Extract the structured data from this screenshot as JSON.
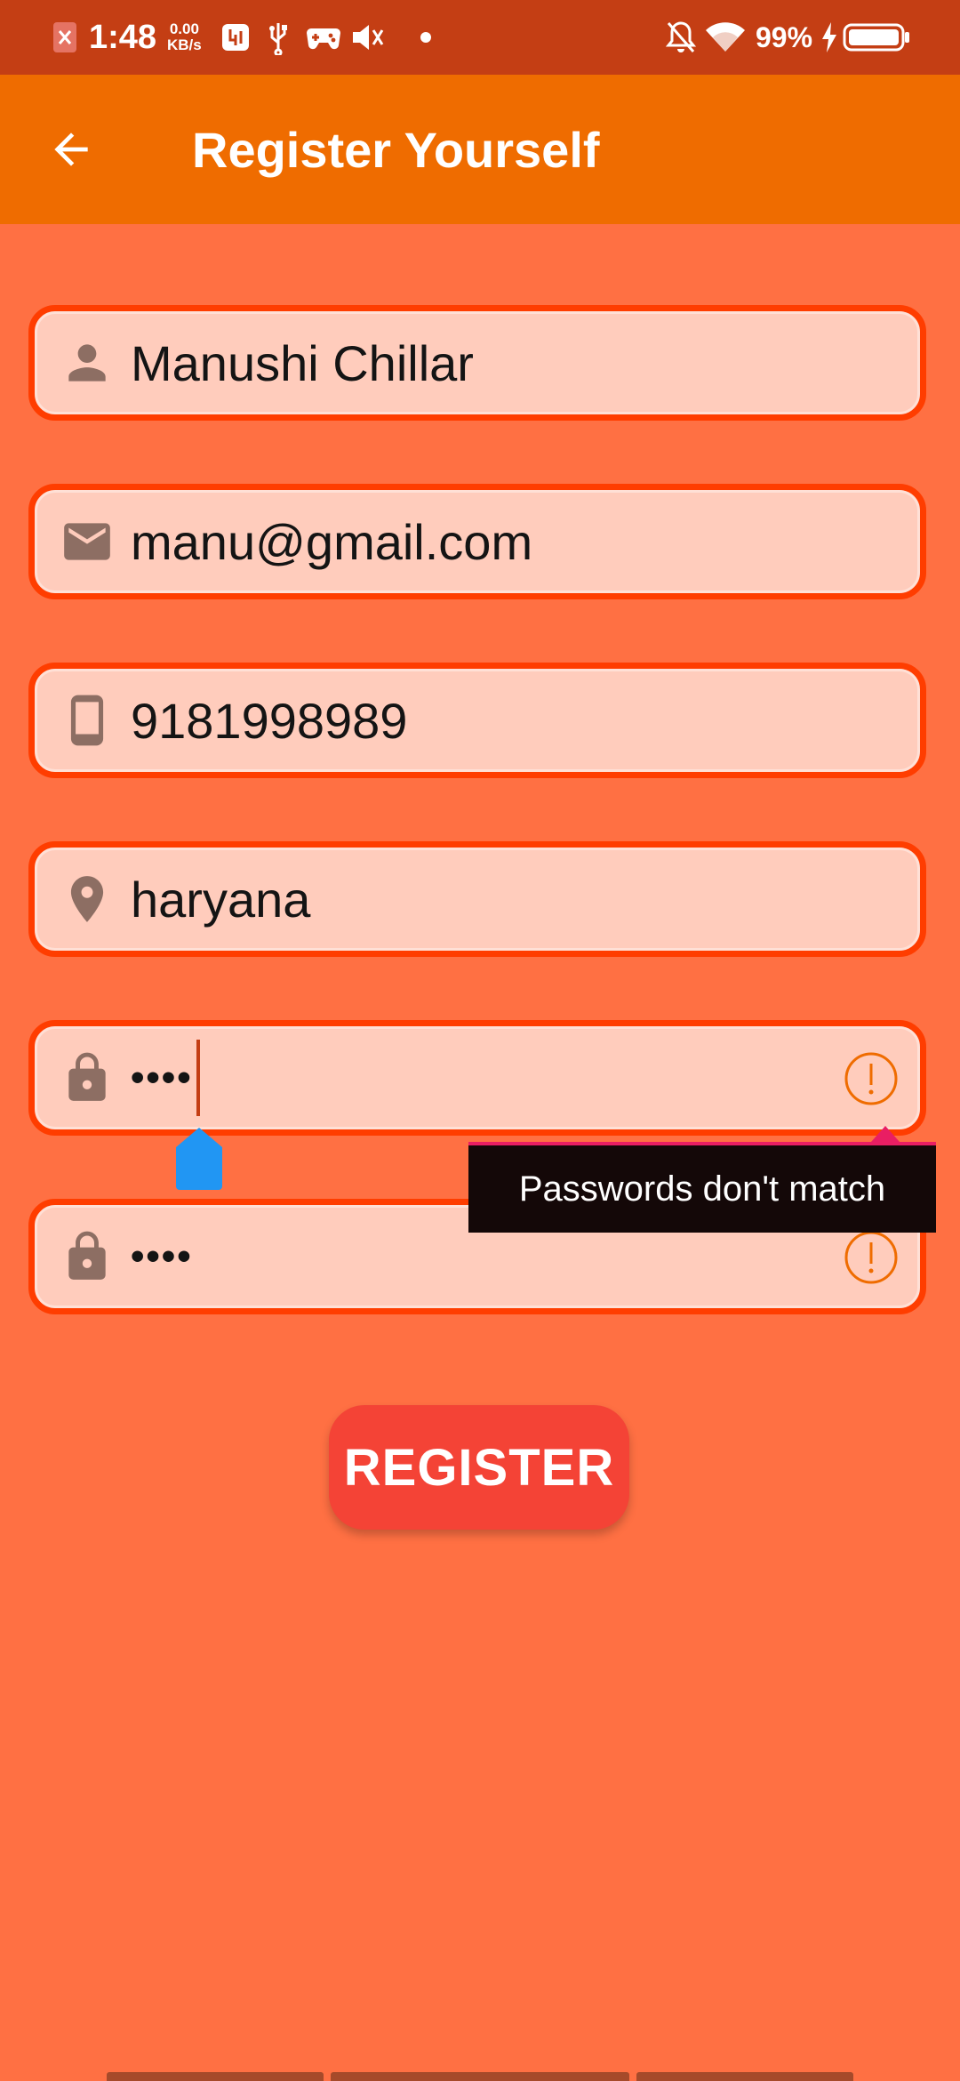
{
  "status_bar": {
    "time": "1:48",
    "net_speed_value": "0.00",
    "net_speed_unit": "KB/s",
    "battery_percent": "99%",
    "icons": [
      "notification-x-icon",
      "data-saver-icon",
      "usb-icon",
      "game-controller-icon",
      "volume-muted-icon",
      "dot-icon",
      "bell-off-icon",
      "wifi-icon",
      "charging-icon",
      "battery-icon"
    ]
  },
  "app_bar": {
    "title": "Register Yourself",
    "back_icon": "arrow-back-icon"
  },
  "form": {
    "name": {
      "value": "Manushi Chillar",
      "icon": "person-icon"
    },
    "email": {
      "value": "manu@gmail.com",
      "icon": "email-icon"
    },
    "phone": {
      "value": "9181998989",
      "icon": "phone-icon"
    },
    "location": {
      "value": "haryana",
      "icon": "location-pin-icon"
    },
    "password": {
      "value": "••••",
      "icon": "lock-icon"
    },
    "confirm_password": {
      "value": "••••",
      "icon": "lock-icon"
    },
    "error_message": "Passwords don't match",
    "register_label": "REGISTER"
  },
  "colors": {
    "background": "#ff7043",
    "app_bar": "#ef6c00",
    "status_bar": "#c43e14",
    "field_border": "#ff3d00",
    "field_fill": "#ffccbc",
    "button": "#f44336",
    "error_icon": "#ef6c00"
  }
}
